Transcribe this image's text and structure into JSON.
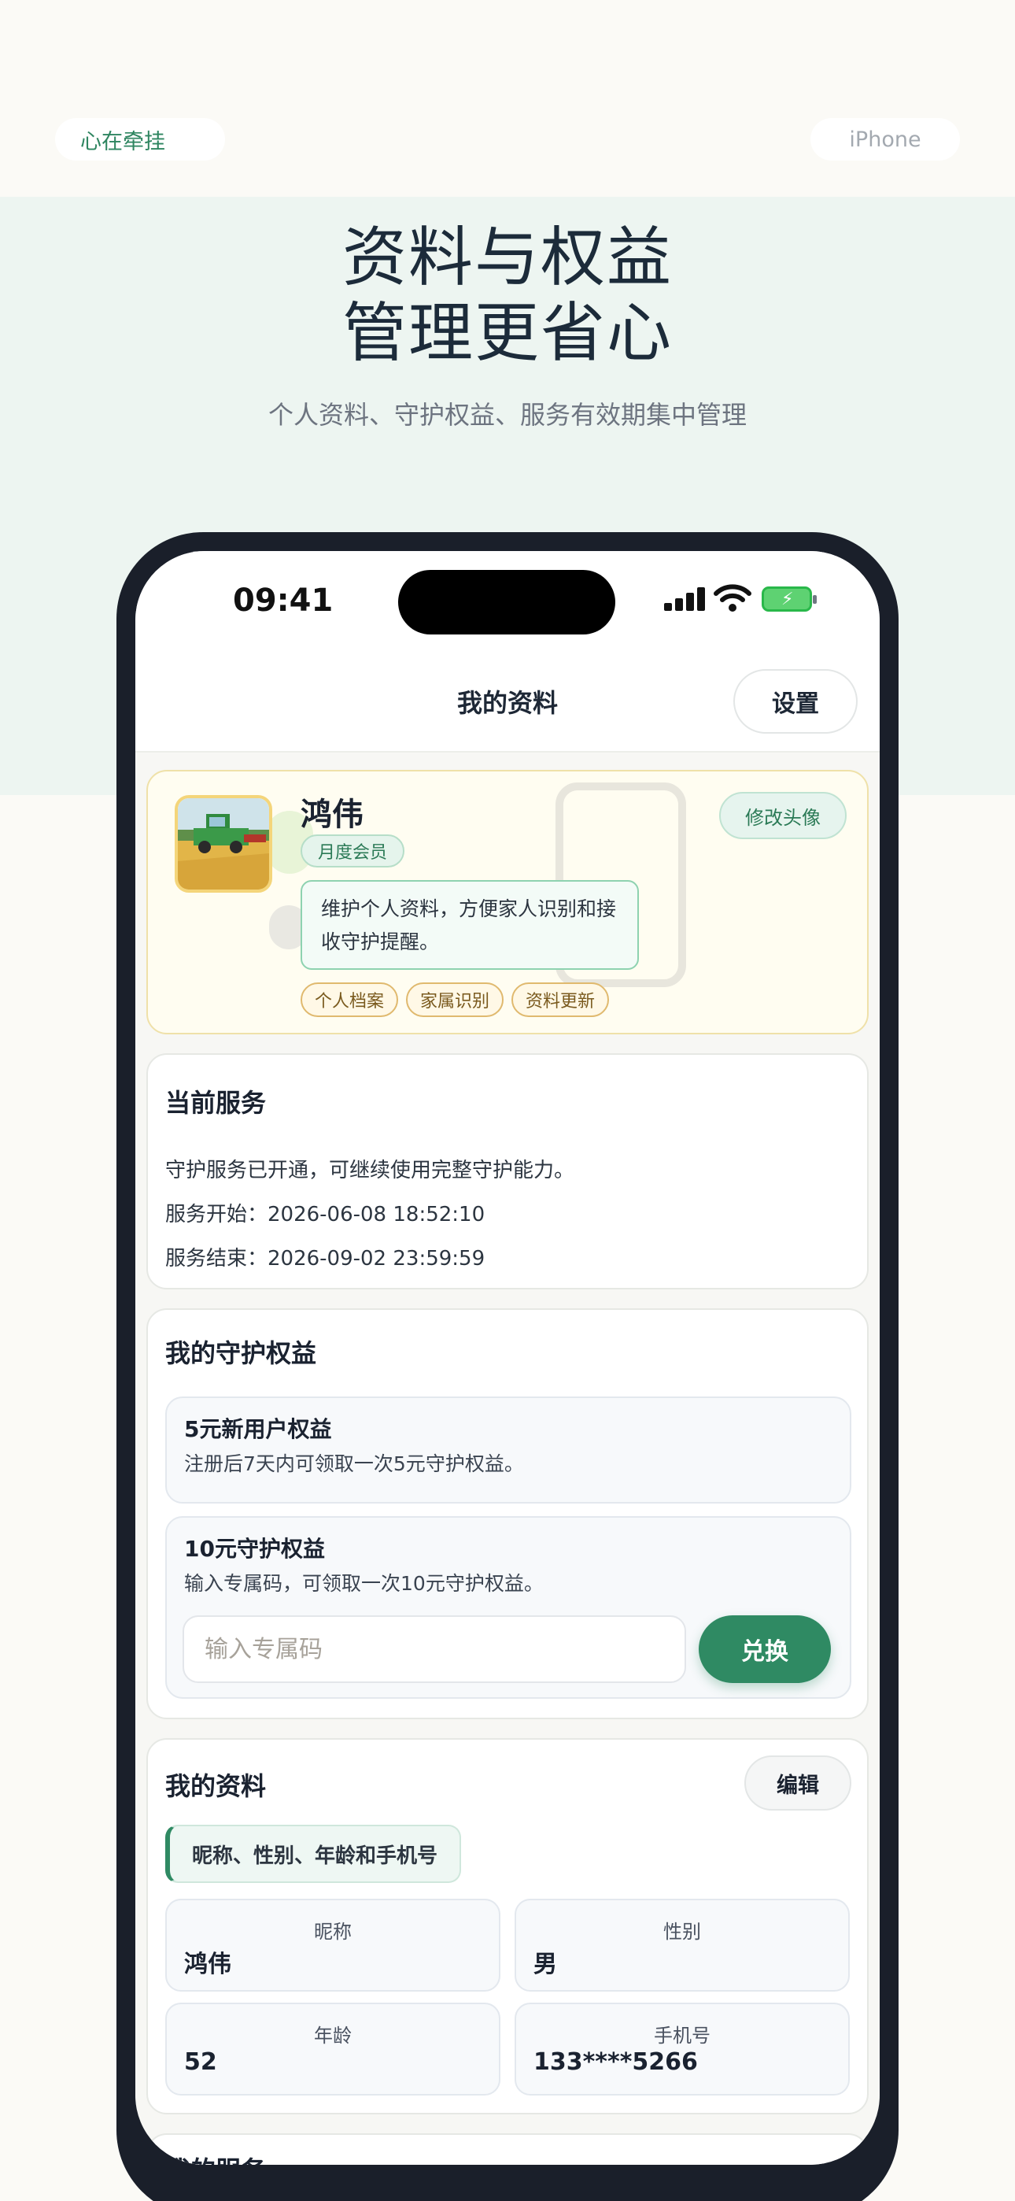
{
  "page": {
    "brand_pill": "心在牵挂",
    "device_pill": "iPhone",
    "headline_line1": "资料与权益",
    "headline_line2": "管理更省心",
    "subtitle": "个人资料、守护权益、服务有效期集中管理"
  },
  "status_bar": {
    "time": "09:41",
    "icons": [
      "signal-icon",
      "wifi-icon",
      "battery-charging-icon"
    ],
    "battery_color": "#5ed272"
  },
  "nav": {
    "title": "我的资料",
    "settings_label": "设置"
  },
  "profile": {
    "name": "鸿伟",
    "membership": "月度会员",
    "description": "维护个人资料，方便家人识别和接收守护提醒。",
    "tags": [
      "个人档案",
      "家属识别",
      "资料更新"
    ],
    "change_avatar_label": "修改头像"
  },
  "service": {
    "title": "当前服务",
    "status_text": "守护服务已开通，可继续使用完整守护能力。",
    "start_text": "服务开始：2026-06-08 18:52:10",
    "end_text": "服务结束：2026-09-02 23:59:59"
  },
  "rights": {
    "title": "我的守护权益",
    "items": [
      {
        "title": "5元新用户权益",
        "desc": "注册后7天内可领取一次5元守护权益。"
      },
      {
        "title": "10元守护权益",
        "desc": "输入专属码，可领取一次10元守护权益。"
      }
    ],
    "code_placeholder": "输入专属码",
    "redeem_label": "兑换"
  },
  "my_info": {
    "title": "我的资料",
    "edit_label": "编辑",
    "hint": "昵称、性别、年龄和手机号",
    "fields": [
      {
        "label": "昵称",
        "value": "鸿伟"
      },
      {
        "label": "性别",
        "value": "男"
      },
      {
        "label": "年龄",
        "value": "52"
      },
      {
        "label": "手机号",
        "value": "133****5266"
      }
    ]
  },
  "next_section": {
    "title": "我的服务"
  },
  "colors": {
    "accent": "#2f8a63",
    "hero_background": "#edf5f1",
    "page_background": "#fbfaf6",
    "phone_frame": "#1a1f2a"
  }
}
